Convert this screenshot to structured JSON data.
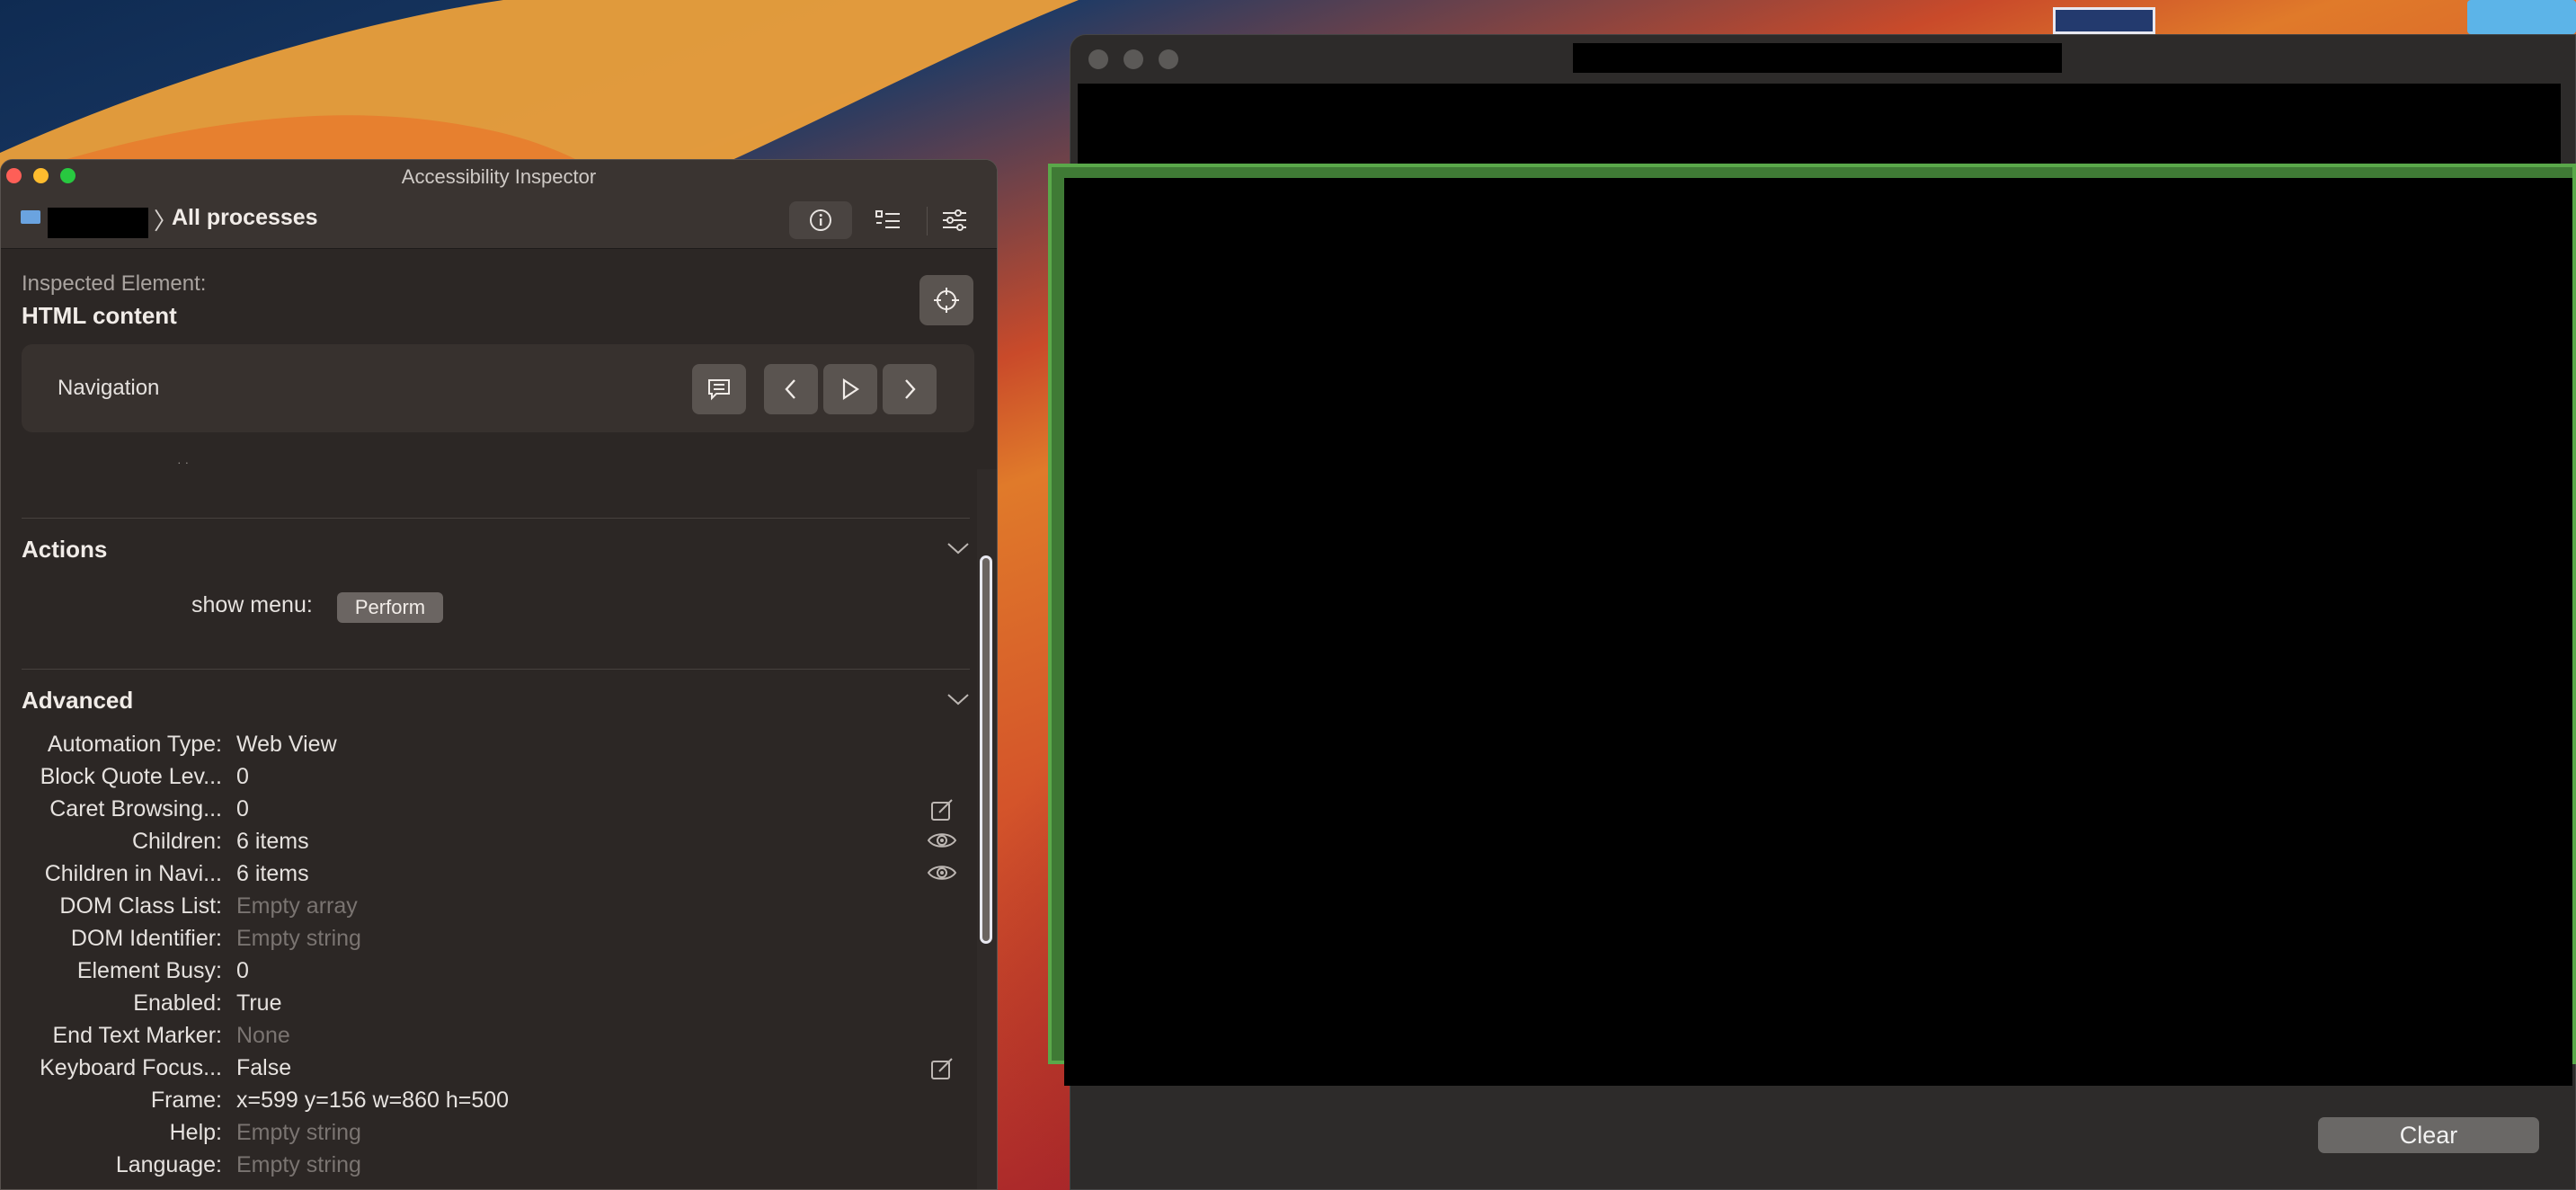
{
  "inspector": {
    "title": "Accessibility Inspector",
    "toolbar": {
      "process_label": "All processes",
      "icons": [
        "laptop-icon",
        "info-icon",
        "hierarchy-icon",
        "settings-sliders-icon"
      ]
    },
    "inspected_label": "Inspected Element:",
    "inspected_value": "HTML content",
    "navigation": {
      "label": "Navigation",
      "icons": [
        "speech-bubble-icon",
        "previous-icon",
        "play-icon",
        "next-icon"
      ]
    },
    "actions": {
      "title": "Actions",
      "label": "show menu:",
      "button": "Perform"
    },
    "advanced": {
      "title": "Advanced",
      "rows": [
        {
          "key": "Automation Type:",
          "value": "Web View",
          "dim": false,
          "icon": ""
        },
        {
          "key": "Block Quote Lev...",
          "value": "0",
          "dim": false,
          "icon": ""
        },
        {
          "key": "Caret Browsing...",
          "value": "0",
          "dim": false,
          "icon": "edit-icon"
        },
        {
          "key": "Children:",
          "value": "6 items",
          "dim": false,
          "icon": "eye-icon"
        },
        {
          "key": "Children in Navi...",
          "value": "6 items",
          "dim": false,
          "icon": "eye-icon"
        },
        {
          "key": "DOM Class List:",
          "value": "Empty array",
          "dim": true,
          "icon": ""
        },
        {
          "key": "DOM Identifier:",
          "value": "Empty string",
          "dim": true,
          "icon": ""
        },
        {
          "key": "Element Busy:",
          "value": "0",
          "dim": false,
          "icon": ""
        },
        {
          "key": "Enabled:",
          "value": "True",
          "dim": false,
          "icon": ""
        },
        {
          "key": "End Text Marker:",
          "value": "None",
          "dim": true,
          "icon": ""
        },
        {
          "key": "Keyboard Focus...",
          "value": "False",
          "dim": false,
          "icon": "edit-icon"
        },
        {
          "key": "Frame:",
          "value": "x=599 y=156 w=860 h=500",
          "dim": false,
          "icon": ""
        },
        {
          "key": "Help:",
          "value": "Empty string",
          "dim": true,
          "icon": ""
        },
        {
          "key": "Language:",
          "value": "Empty string",
          "dim": true,
          "icon": ""
        }
      ]
    }
  },
  "right_window": {
    "clear_button": "Clear"
  },
  "colors": {
    "highlight_green": "#5aa84a",
    "inspector_bg": "#2c2725"
  }
}
